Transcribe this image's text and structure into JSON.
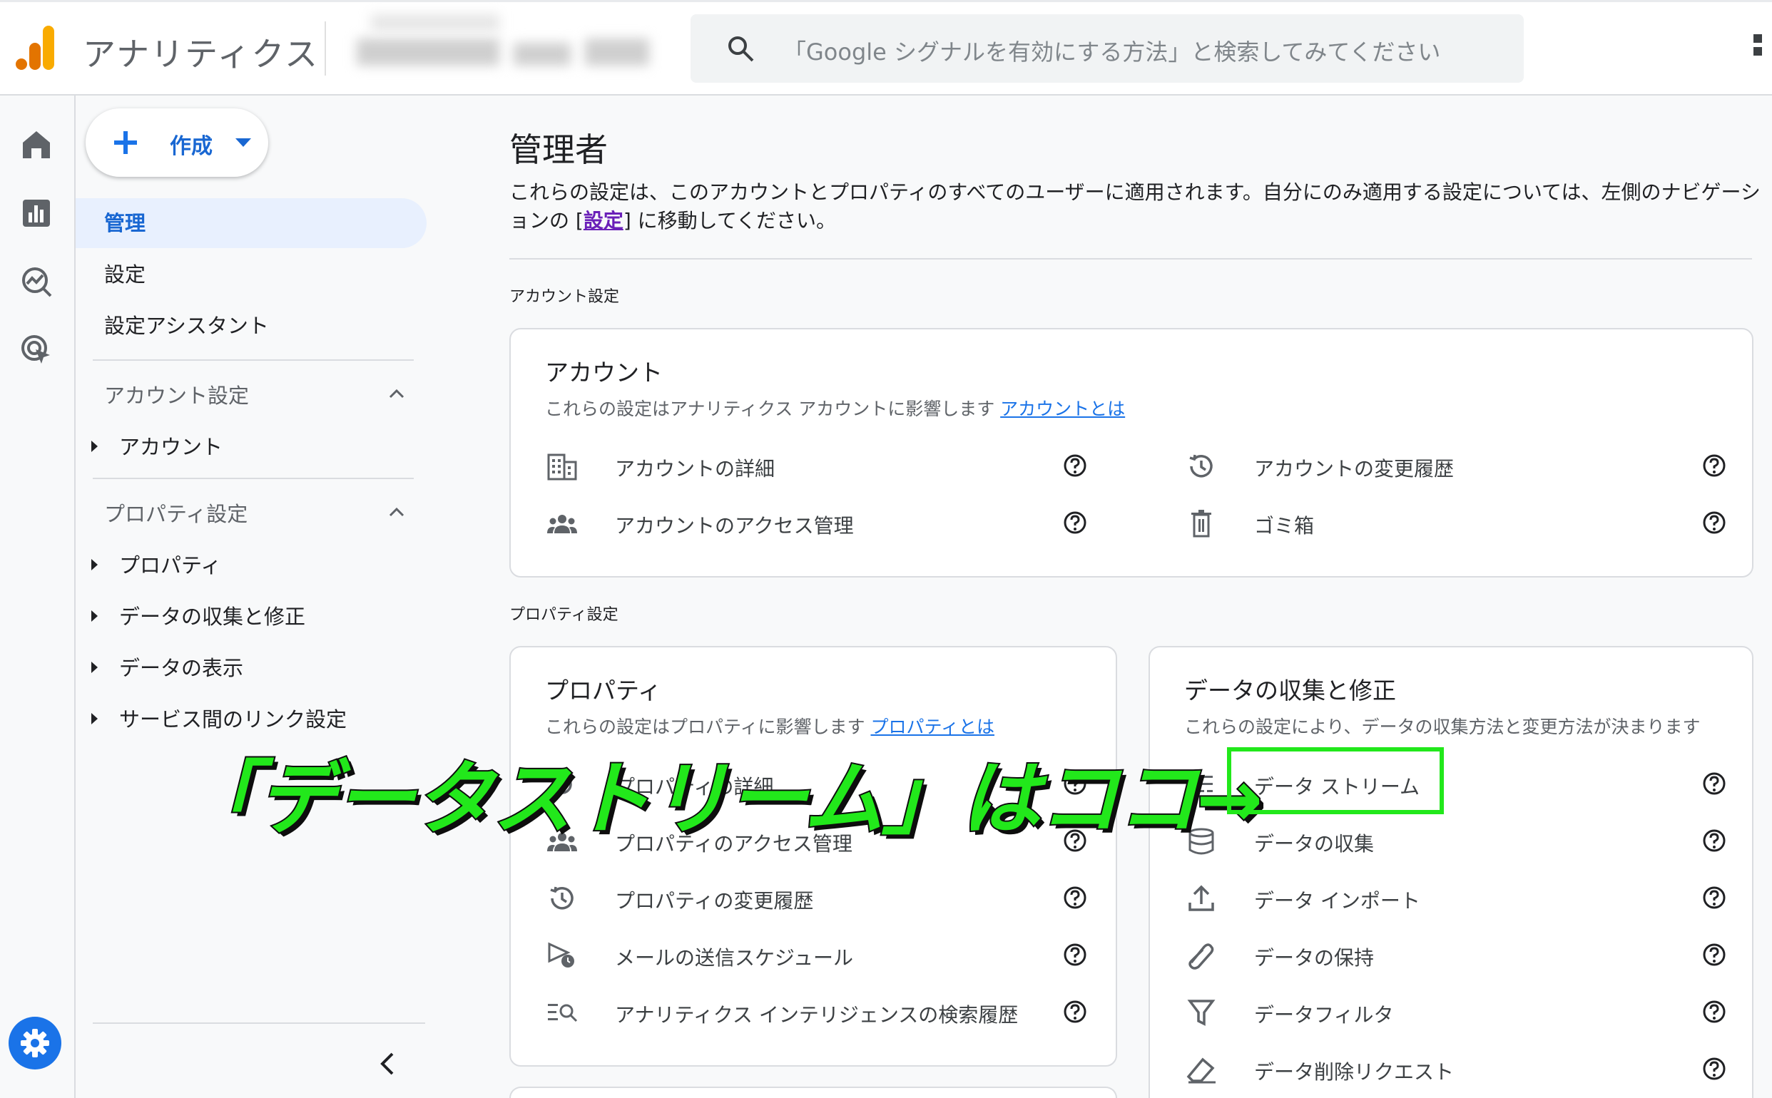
{
  "app": {
    "title": "アナリティクス"
  },
  "search": {
    "placeholder": "「Google シグナルを有効にする方法」と検索してみてください"
  },
  "sidebar": {
    "create_label": "作成",
    "top_items": [
      {
        "label": "管理",
        "active": true
      },
      {
        "label": "設定",
        "active": false
      },
      {
        "label": "設定アシスタント",
        "active": false
      }
    ],
    "account_section": {
      "title": "アカウント設定",
      "items": [
        "アカウント"
      ]
    },
    "property_section": {
      "title": "プロパティ設定",
      "items": [
        "プロパティ",
        "データの収集と修正",
        "データの表示",
        "サービス間のリンク設定"
      ]
    }
  },
  "main": {
    "title": "管理者",
    "desc_before": "これらの設定は、このアカウントとプロパティのすべてのユーザーに適用されます。自分にのみ適用する設定については、左側のナビゲーションの [",
    "desc_link": "設定",
    "desc_after": "] に移動してください。",
    "account_section_label": "アカウント設定",
    "property_section_label": "プロパティ設定"
  },
  "account_card": {
    "title": "アカウント",
    "desc": "これらの設定はアナリティクス アカウントに影響します",
    "link": "アカウントとは",
    "items": [
      {
        "label": "アカウントの詳細",
        "icon": "building-icon"
      },
      {
        "label": "アカウントのアクセス管理",
        "icon": "people-icon"
      },
      {
        "label": "アカウントの変更履歴",
        "icon": "history-icon"
      },
      {
        "label": "ゴミ箱",
        "icon": "trash-icon"
      }
    ]
  },
  "property_card": {
    "title": "プロパティ",
    "desc": "これらの設定はプロパティに影響します",
    "link": "プロパティとは",
    "items": [
      {
        "label": "プロパティの詳細",
        "icon": "settings-icon"
      },
      {
        "label": "プロパティのアクセス管理",
        "icon": "people-icon"
      },
      {
        "label": "プロパティの変更履歴",
        "icon": "history-icon"
      },
      {
        "label": "メールの送信スケジュール",
        "icon": "scheduled-send-icon"
      },
      {
        "label": "アナリティクス インテリジェンスの検索履歴",
        "icon": "search-history-icon"
      }
    ]
  },
  "data_card": {
    "title": "データの収集と修正",
    "desc": "これらの設定により、データの収集方法と変更方法が決まります",
    "items": [
      {
        "label": "データ ストリーム",
        "icon": "streams-icon"
      },
      {
        "label": "データの収集",
        "icon": "database-icon"
      },
      {
        "label": "データ インポート",
        "icon": "upload-icon"
      },
      {
        "label": "データの保持",
        "icon": "retention-icon"
      },
      {
        "label": "データフィルタ",
        "icon": "filter-icon"
      },
      {
        "label": "データ削除リクエスト",
        "icon": "eraser-icon"
      }
    ]
  },
  "annotation": {
    "text": "「データストリーム」はココ→"
  },
  "colors": {
    "accent": "#1a73e8",
    "annotation": "#22e81b",
    "logo_orange": "#f9ab00",
    "logo_dark": "#e37400"
  }
}
